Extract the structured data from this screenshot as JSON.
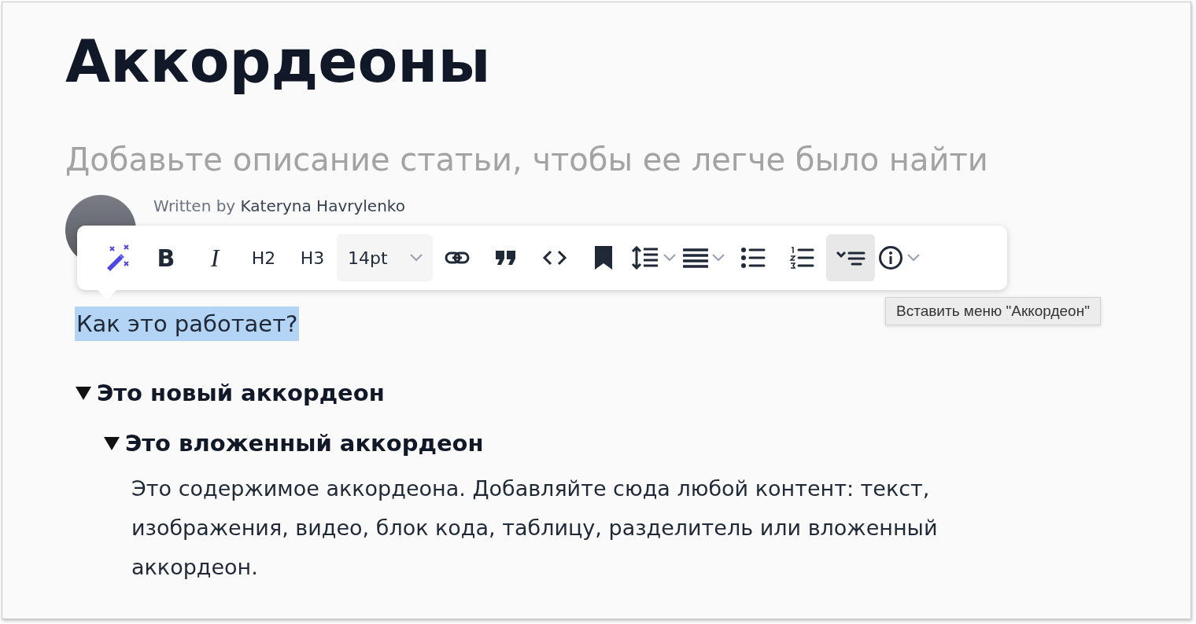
{
  "article": {
    "title": "Аккордеоны",
    "description_placeholder": "Добавьте описание статьи, чтобы ее легче было найти",
    "byline_prefix": "Written by",
    "author": "Kateryna Havrylenko"
  },
  "toolbar": [
    {
      "kind": "wand",
      "active": false,
      "dropdown": false
    },
    {
      "kind": "bold",
      "label": "B",
      "active": false,
      "dropdown": false
    },
    {
      "kind": "italic",
      "label": "I",
      "active": false,
      "dropdown": false
    },
    {
      "kind": "text",
      "label": "H2",
      "active": false,
      "dropdown": false
    },
    {
      "kind": "text",
      "label": "H3",
      "active": false,
      "dropdown": false
    },
    {
      "kind": "select",
      "label": "14pt",
      "active": false,
      "dropdown": true
    },
    {
      "kind": "link",
      "active": false,
      "dropdown": false
    },
    {
      "kind": "quote",
      "active": false,
      "dropdown": false
    },
    {
      "kind": "code",
      "active": false,
      "dropdown": false
    },
    {
      "kind": "bookmark",
      "active": false,
      "dropdown": false
    },
    {
      "kind": "line-height",
      "active": false,
      "dropdown": true
    },
    {
      "kind": "align",
      "active": false,
      "dropdown": true
    },
    {
      "kind": "bullets",
      "active": false,
      "dropdown": false
    },
    {
      "kind": "numbers",
      "active": false,
      "dropdown": false
    },
    {
      "kind": "accordion",
      "active": true,
      "dropdown": false
    },
    {
      "kind": "info",
      "active": false,
      "dropdown": true
    }
  ],
  "tooltip": "Вставить меню \"Аккордеон\"",
  "selected_text": "Как это работает?",
  "accordions": [
    {
      "title": "Это новый аккордеон",
      "expanded": true,
      "children": [
        {
          "title": "Это вложенный аккордеон",
          "expanded": true,
          "body": "Это содержимое аккордеона. Добавляйте сюда любой контент: текст, изображения, видео, блок кода, таблицу, разделитель или вложенный аккордеон."
        }
      ]
    }
  ]
}
